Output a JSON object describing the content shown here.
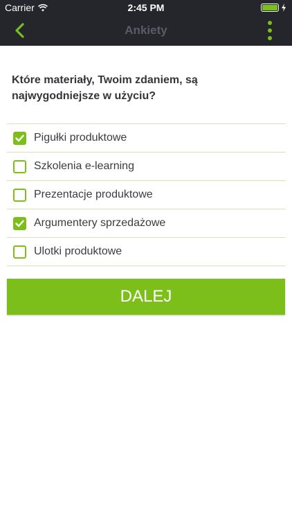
{
  "status_bar": {
    "carrier": "Carrier",
    "time": "2:45 PM"
  },
  "nav": {
    "title": "Ankiety",
    "back_icon": "chevron-left-icon",
    "menu_icon": "more-vertical-icon"
  },
  "question": "Które materiały, Twoim zdaniem, są najwygodniejsze w użyciu?",
  "options": [
    {
      "label": "Pigułki produktowe",
      "checked": true
    },
    {
      "label": "Szkolenia e-learning",
      "checked": false
    },
    {
      "label": "Prezentacje produktowe",
      "checked": false
    },
    {
      "label": "Argumentery sprzedażowe",
      "checked": true
    },
    {
      "label": "Ulotki produktowe",
      "checked": false
    }
  ],
  "next_button": "DALEJ",
  "colors": {
    "accent": "#7dbf1a",
    "topbar": "#24262b",
    "divider": "#d5e3b8"
  }
}
